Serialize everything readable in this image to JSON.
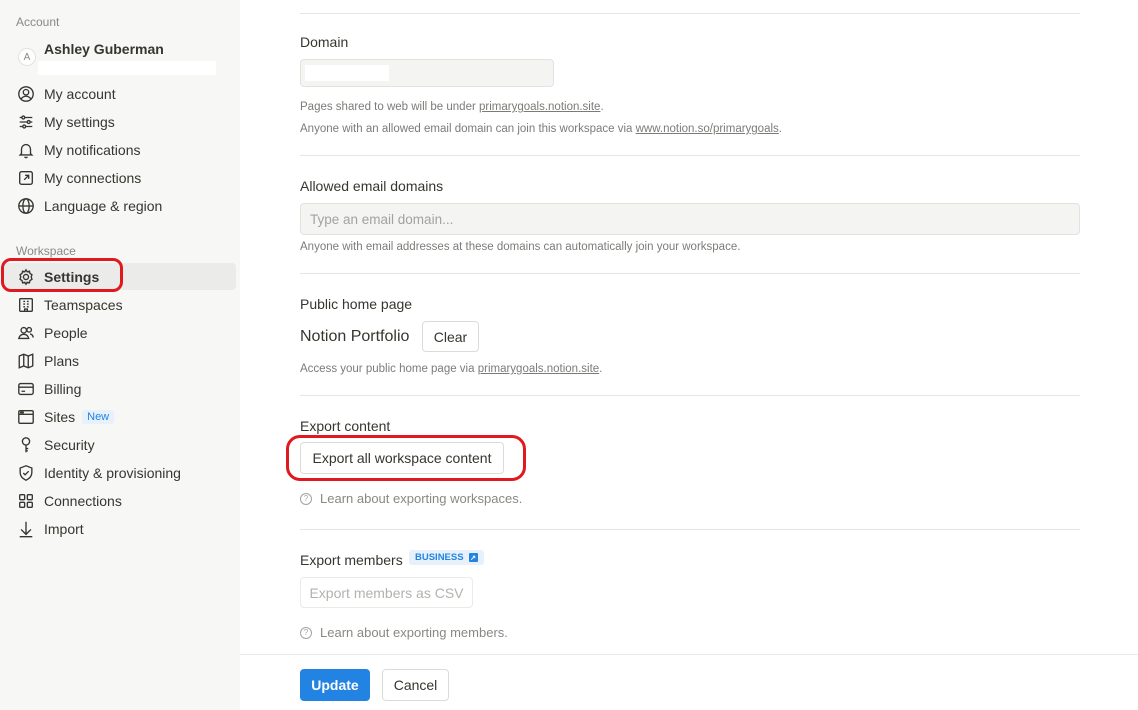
{
  "sidebar": {
    "account_label": "Account",
    "user_name": "Ashley Guberman",
    "avatar_initial": "A",
    "account_items": [
      {
        "label": "My account",
        "icon": "user-circle-icon"
      },
      {
        "label": "My settings",
        "icon": "sliders-icon"
      },
      {
        "label": "My notifications",
        "icon": "bell-icon"
      },
      {
        "label": "My connections",
        "icon": "external-link-icon"
      },
      {
        "label": "Language & region",
        "icon": "globe-icon"
      }
    ],
    "workspace_label": "Workspace",
    "workspace_items": [
      {
        "label": "Settings",
        "icon": "gear-icon",
        "active": true
      },
      {
        "label": "Teamspaces",
        "icon": "building-icon"
      },
      {
        "label": "People",
        "icon": "people-icon"
      },
      {
        "label": "Plans",
        "icon": "map-icon"
      },
      {
        "label": "Billing",
        "icon": "credit-card-icon"
      },
      {
        "label": "Sites",
        "icon": "browser-window-icon",
        "badge": "New"
      },
      {
        "label": "Security",
        "icon": "key-icon"
      },
      {
        "label": "Identity & provisioning",
        "icon": "shield-check-icon"
      },
      {
        "label": "Connections",
        "icon": "grid-icon"
      },
      {
        "label": "Import",
        "icon": "arrow-down-icon"
      }
    ]
  },
  "main": {
    "domain": {
      "title": "Domain",
      "note_prefix": "Pages shared to web will be under ",
      "note_link": "primarygoals.notion.site",
      "note_suffix": ".",
      "join_prefix": "Anyone with an allowed email domain can join this workspace via ",
      "join_link": "www.notion.so/primarygoals",
      "join_suffix": "."
    },
    "allowed_email": {
      "title": "Allowed email domains",
      "placeholder": "Type an email domain...",
      "note": "Anyone with email addresses at these domains can automatically join your workspace."
    },
    "public_home": {
      "title": "Public home page",
      "page_name": "Notion Portfolio",
      "clear_label": "Clear",
      "note_prefix": "Access your public home page via ",
      "note_link": "primarygoals.notion.site",
      "note_suffix": "."
    },
    "export_content": {
      "title": "Export content",
      "button_label": "Export all workspace content",
      "help_text": "Learn about exporting workspaces."
    },
    "export_members": {
      "title": "Export members",
      "badge": "BUSINESS",
      "button_label": "Export members as CSV",
      "help_text": "Learn about exporting members."
    },
    "footer": {
      "update_label": "Update",
      "cancel_label": "Cancel"
    }
  },
  "colors": {
    "accent": "#2383e2",
    "highlight": "#e0191e",
    "sidebar_bg": "#f7f7f5"
  }
}
